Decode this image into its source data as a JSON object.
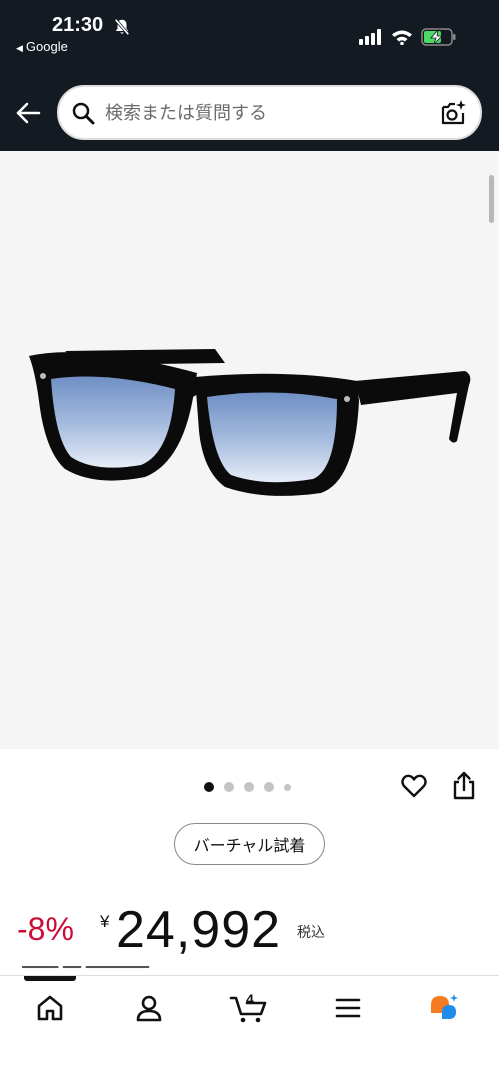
{
  "status_bar": {
    "time": "21:30",
    "back_app": "Google",
    "icons": [
      "bell-muted-icon",
      "signal-icon",
      "wifi-icon",
      "battery-charging-icon"
    ]
  },
  "search": {
    "placeholder": "検索または質問する",
    "value": ""
  },
  "gallery": {
    "image_count": 5,
    "active_index": 0
  },
  "virtual_try_on": "バーチャル試着",
  "price": {
    "discount": "-8%",
    "currency": "¥",
    "amount": "24,992",
    "tax": "税込"
  },
  "bottom_nav": {
    "items": [
      "home-icon",
      "account-icon",
      "cart-icon",
      "menu-icon",
      "rufus-icon"
    ],
    "cart_count": "4"
  },
  "colors": {
    "header_bg": "#131a22",
    "discount_red": "#cc0c39",
    "image_bg": "#f5f5f5"
  }
}
